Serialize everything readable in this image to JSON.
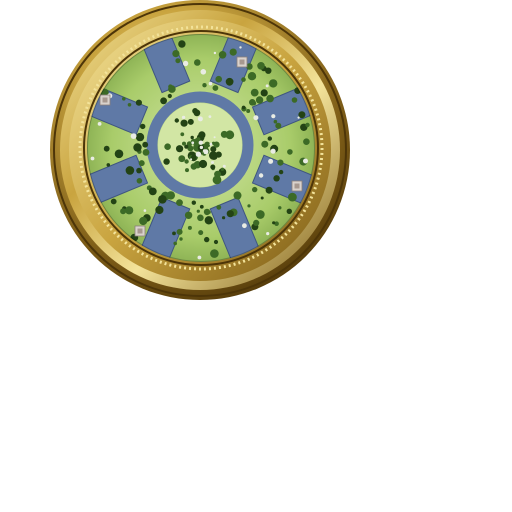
{
  "minimap": {
    "frame_style": "ornate-gold-round",
    "colors": {
      "background": "#ffffff",
      "gold_light": "#f3e39a",
      "gold_mid": "#c9a43f",
      "gold_dark": "#7a5a16",
      "gold_shadow": "#4d3508",
      "grass_light": "#d2e6a4",
      "grass_mid": "#a9cc6a",
      "grass_dark": "#7fa64a",
      "water": "#5f79a6",
      "water_edge": "#3f5680",
      "tree": "#3c6a26",
      "tree_dark": "#234315",
      "rock": "#e9ece4",
      "building": "#d9d2cc"
    },
    "terrain": {
      "central_island": "grass",
      "ring_channel": "water",
      "spokes": 8,
      "spoke_type": "water-channel"
    },
    "structures": [
      {
        "name": "building-top-right",
        "icon": "building-icon"
      },
      {
        "name": "building-left",
        "icon": "building-icon"
      },
      {
        "name": "building-right",
        "icon": "building-icon"
      },
      {
        "name": "building-bottom-left",
        "icon": "building-icon"
      }
    ]
  }
}
